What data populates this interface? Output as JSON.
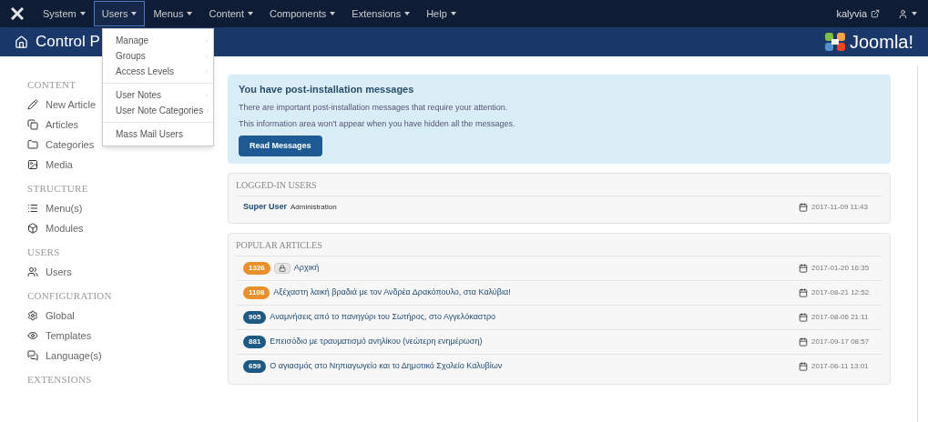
{
  "top_menu": [
    {
      "label": "System",
      "selected": false
    },
    {
      "label": "Users",
      "selected": true
    },
    {
      "label": "Menus",
      "selected": false
    },
    {
      "label": "Content",
      "selected": false
    },
    {
      "label": "Components",
      "selected": false
    },
    {
      "label": "Extensions",
      "selected": false
    },
    {
      "label": "Help",
      "selected": false
    }
  ],
  "site_link": "kalyvia",
  "header": {
    "title": "Control P",
    "logo_text": "Joomla!"
  },
  "dropdown": {
    "groups": [
      [
        {
          "label": "Manage",
          "submenu": true
        },
        {
          "label": "Groups",
          "submenu": true
        },
        {
          "label": "Access Levels",
          "submenu": true
        }
      ],
      [
        {
          "label": "User Notes",
          "submenu": true
        },
        {
          "label": "User Note Categories",
          "submenu": true
        }
      ],
      [
        {
          "label": "Mass Mail Users",
          "submenu": false
        }
      ]
    ]
  },
  "sidebar": [
    {
      "heading": "CONTENT",
      "items": [
        "New Article",
        "Articles",
        "Categories",
        "Media"
      ]
    },
    {
      "heading": "STRUCTURE",
      "items": [
        "Menu(s)",
        "Modules"
      ]
    },
    {
      "heading": "USERS",
      "items": [
        "Users"
      ]
    },
    {
      "heading": "CONFIGURATION",
      "items": [
        "Global",
        "Templates",
        "Language(s)"
      ]
    },
    {
      "heading": "EXTENSIONS"
    }
  ],
  "alert": {
    "title": "You have post-installation messages",
    "lines": [
      "There are important post-installation messages that require your attention.",
      "This information area won't appear when you have hidden all the messages."
    ],
    "button": "Read Messages"
  },
  "logged_in": {
    "title": "LOGGED-IN USERS",
    "rows": [
      {
        "name": "Super User",
        "role": "Administration",
        "date": "2017-11-09 11:43"
      }
    ]
  },
  "popular": {
    "title": "POPULAR ARTICLES",
    "rows": [
      {
        "hits": "1326",
        "color": "#e8902a",
        "locked": true,
        "title": "Αρχική",
        "date": "2017-01-20 16:35"
      },
      {
        "hits": "1108",
        "color": "#e8902a",
        "locked": false,
        "title": "Αξέχαστη λαική βραδιά με τον Ανδρέα Δρακόπουλο, στα Καλύβια!",
        "date": "2017-08-21 12:52"
      },
      {
        "hits": "905",
        "color": "#1c5a84",
        "locked": false,
        "title": "Αναμνήσεις από το πανηγύρι του Σωτήρος, στο Αγγελόκαστρο",
        "date": "2017-08-06 21:11"
      },
      {
        "hits": "881",
        "color": "#1c5a84",
        "locked": false,
        "title": "Επεισόδιο με τραυματισμό ανηλίκου (νεώτερη ενημέρωση)",
        "date": "2017-09-17 08:57"
      },
      {
        "hits": "659",
        "color": "#1c5a84",
        "locked": false,
        "title": "Ο αγιασμός στο Νηπιαγωγείο και το Δημοτικό Σχολείο Καλυβίων",
        "date": "2017-06-11 13:01"
      }
    ]
  }
}
